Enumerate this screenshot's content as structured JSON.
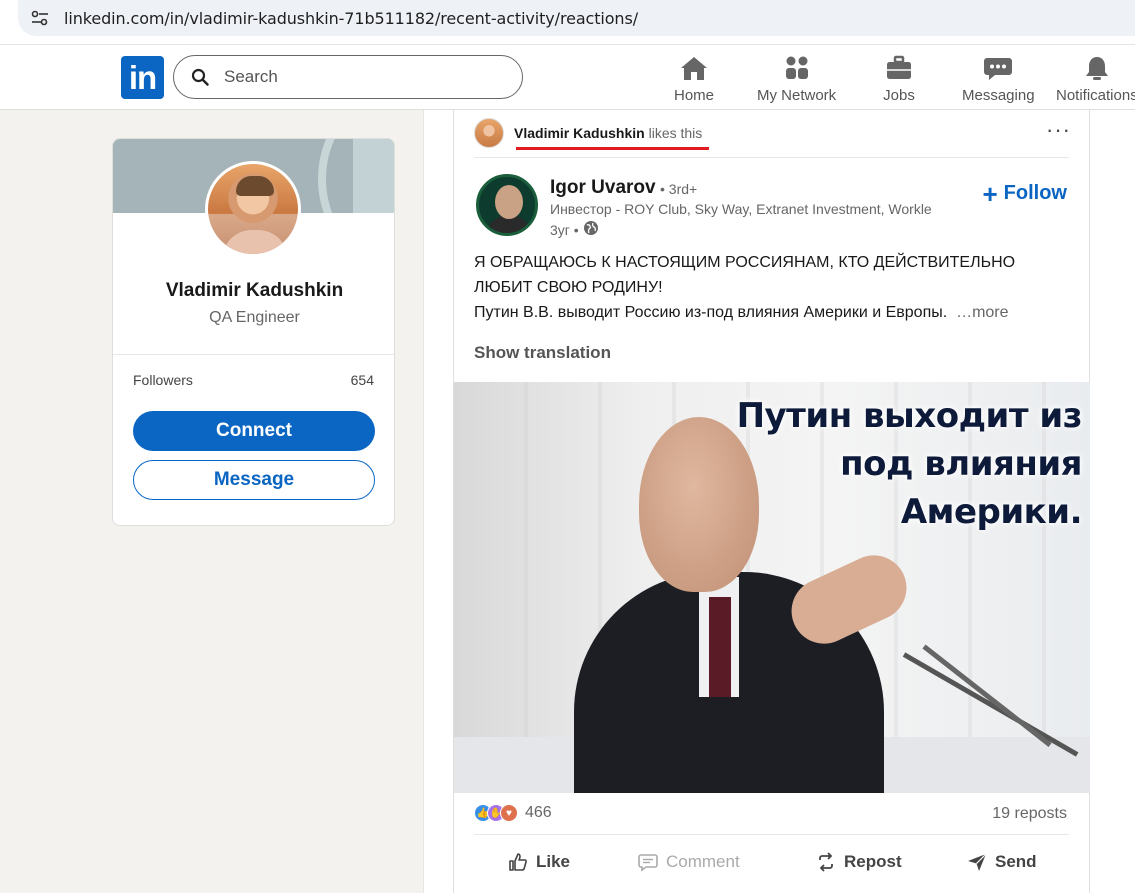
{
  "browser": {
    "url": "linkedin.com/in/vladimir-kadushkin-71b511182/recent-activity/reactions/"
  },
  "header": {
    "logo": "in",
    "search_placeholder": "Search",
    "nav": [
      {
        "label": "Home",
        "icon": "home-icon"
      },
      {
        "label": "My Network",
        "icon": "network-icon"
      },
      {
        "label": "Jobs",
        "icon": "briefcase-icon"
      },
      {
        "label": "Messaging",
        "icon": "chat-icon"
      },
      {
        "label": "Notifications",
        "icon": "bell-icon"
      }
    ]
  },
  "profile": {
    "name": "Vladimir Kadushkin",
    "title": "QA Engineer",
    "followers_label": "Followers",
    "followers_count": "654",
    "connect_label": "Connect",
    "message_label": "Message"
  },
  "post": {
    "context_name": "Vladimir Kadushkin",
    "context_action": "likes this",
    "author": {
      "name": "Igor Uvarov",
      "degree": "• 3rd+",
      "headline": "Инвестор - ROY Club, Sky Way, Extranet Investment, Workle",
      "time": "3уг •"
    },
    "follow_label": "Follow",
    "text_line1": "Я ОБРАЩАЮСЬ К НАСТОЯЩИМ РОССИЯНАМ, КТО ДЕЙСТВИТЕЛЬНО",
    "text_line2": "ЛЮБИТ СВОЮ РОДИНУ!",
    "text_line3": "Путин В.В. выводит Россию из-под влияния Америки и Европы.",
    "more_label": "…more",
    "show_translation": "Show translation",
    "image_caption": [
      "Путин выходит из",
      "под влияния",
      "Америки."
    ],
    "reaction_count": "466",
    "reposts": "19 reposts",
    "actions": [
      {
        "label": "Like",
        "icon": "thumbs-up-icon"
      },
      {
        "label": "Comment",
        "icon": "comment-icon"
      },
      {
        "label": "Repost",
        "icon": "repost-icon"
      },
      {
        "label": "Send",
        "icon": "send-icon"
      }
    ]
  },
  "colors": {
    "brand": "#0a66c2",
    "highlight_underline": "#e21a22"
  }
}
